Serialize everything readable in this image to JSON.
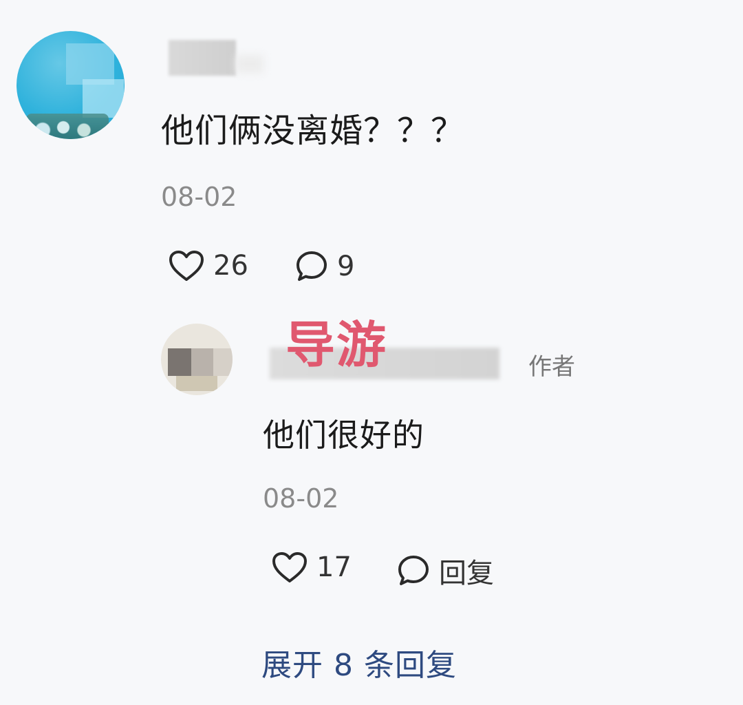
{
  "comment": {
    "text": "他们俩没离婚？？？",
    "date": "08-02",
    "likes": "26",
    "replies": "9"
  },
  "reply": {
    "overlay_label": "导游",
    "author_tag": "作者",
    "text": "他们很好的",
    "date": "08-02",
    "likes": "17",
    "reply_label": "回复"
  },
  "expand_label": "展开 8 条回复",
  "icons": {
    "like": "heart-outline-icon",
    "reply": "speech-bubble-icon"
  }
}
